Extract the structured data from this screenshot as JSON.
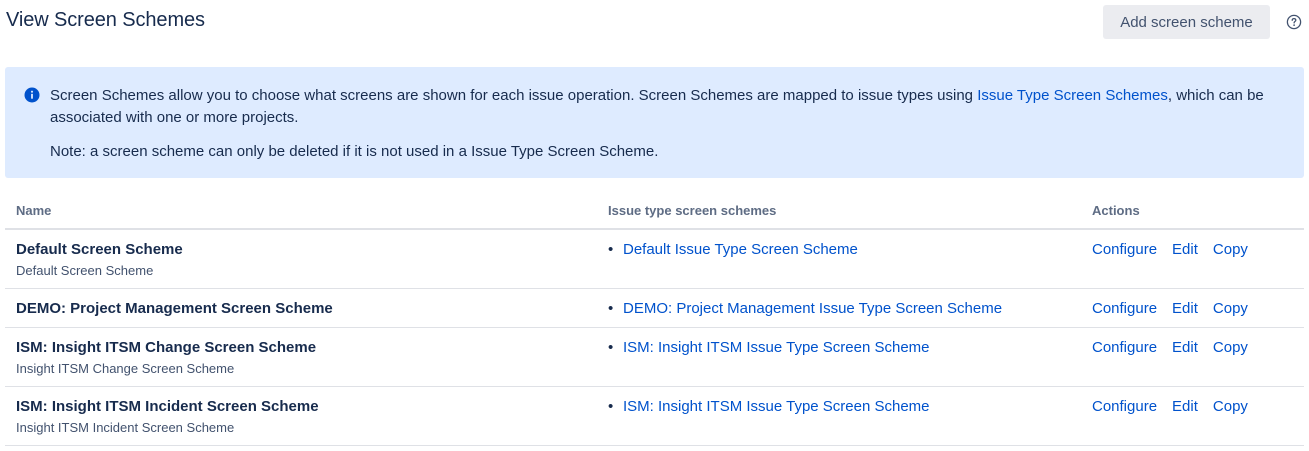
{
  "header": {
    "title": "View Screen Schemes",
    "add_button": "Add screen scheme",
    "help_icon": "question-circle-icon"
  },
  "info": {
    "icon": "info-circle-icon",
    "text_before_link": "Screen Schemes allow you to choose what screens are shown for each issue operation. Screen Schemes are mapped to issue types using ",
    "link": "Issue Type Screen Schemes",
    "text_after_link": ", which can be associated with one or more projects.",
    "note": "Note: a screen scheme can only be deleted if it is not used in a Issue Type Screen Scheme.",
    "background": "#deebff"
  },
  "table": {
    "headers": [
      "Name",
      "Issue type screen schemes",
      "Actions"
    ],
    "rows": [
      {
        "name": "Default Screen Scheme",
        "description": "Default Screen Scheme",
        "scheme": "Default Issue Type Screen Scheme",
        "actions": [
          "Configure",
          "Edit",
          "Copy"
        ]
      },
      {
        "name": "DEMO: Project Management Screen Scheme",
        "description": "",
        "scheme": "DEMO: Project Management Issue Type Screen Scheme",
        "actions": [
          "Configure",
          "Edit",
          "Copy"
        ]
      },
      {
        "name": "ISM: Insight ITSM Change Screen Scheme",
        "description": "Insight ITSM Change Screen Scheme",
        "scheme": "ISM: Insight ITSM Issue Type Screen Scheme",
        "actions": [
          "Configure",
          "Edit",
          "Copy"
        ]
      },
      {
        "name": "ISM: Insight ITSM Incident Screen Scheme",
        "description": "Insight ITSM Incident Screen Scheme",
        "scheme": "ISM: Insight ITSM Issue Type Screen Scheme",
        "actions": [
          "Configure",
          "Edit",
          "Copy"
        ]
      }
    ]
  },
  "colors": {
    "link": "#0052cc",
    "text": "#172b4d",
    "subtle": "#5e6c84"
  }
}
